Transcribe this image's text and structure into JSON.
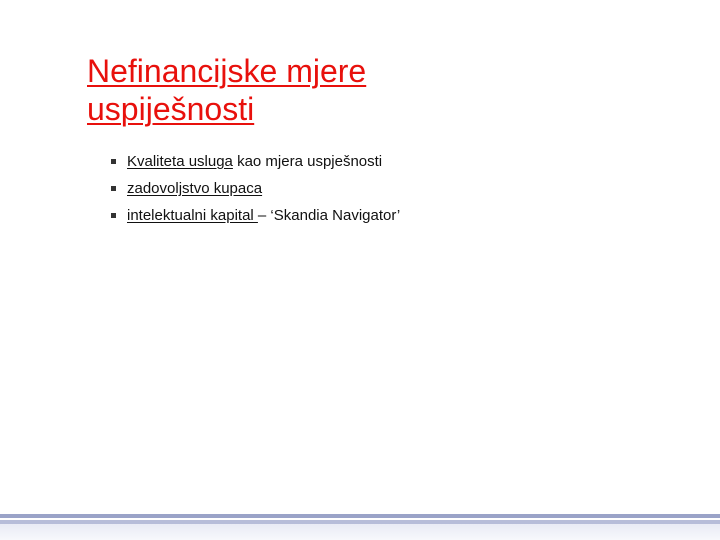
{
  "slide": {
    "title_line1": "Nefinancijske mjere",
    "title_line2": "uspiješnosti",
    "bullets": [
      {
        "underlined": "Kvaliteta usluga",
        "rest": " kao mjera uspješnosti"
      },
      {
        "underlined": "zadovoljstvo kupaca",
        "rest": ""
      },
      {
        "underlined": "intelektualni kapital ",
        "rest": "– ‘Skandia Navigator’"
      }
    ]
  },
  "colors": {
    "title": "#e8100c",
    "body_text": "#111111",
    "footer_band": "#9aa3c8"
  }
}
